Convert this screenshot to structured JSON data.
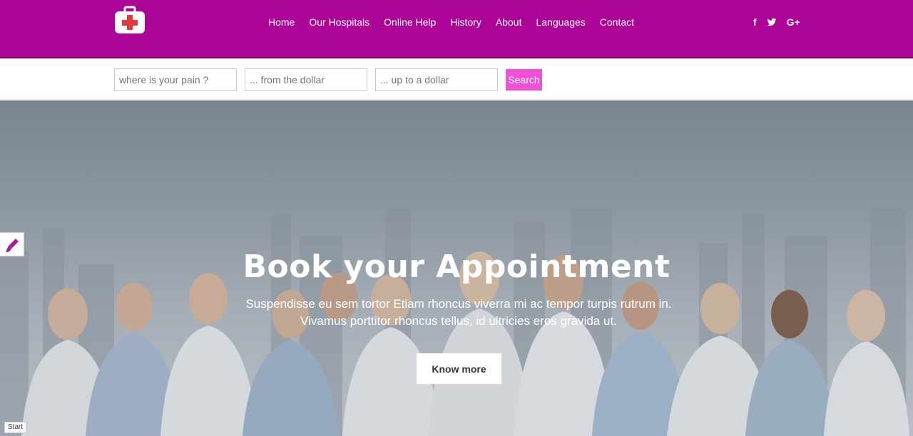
{
  "header": {
    "nav": [
      "Home",
      "Our Hospitals",
      "Online Help",
      "History",
      "About",
      "Languages",
      "Contact"
    ],
    "social": [
      {
        "icon": "facebook-icon",
        "glyph": "f"
      },
      {
        "icon": "twitter-icon",
        "glyph": "🐦"
      },
      {
        "icon": "google-plus-icon",
        "glyph": "G+"
      }
    ]
  },
  "search": {
    "pain_placeholder": "where is your pain ?",
    "from_placeholder": "... from the dollar",
    "to_placeholder": "... up to a dollar",
    "button": "Search"
  },
  "hero": {
    "title": "Book your Appointment",
    "subtitle_line1": "Suspendisse eu sem tortor Etiam rhoncus viverra mi ac tempor turpis rutrum in.",
    "subtitle_line2": "Vivamus porttitor rhoncus tellus, id ultricies eros gravida ut.",
    "button": "Know more"
  },
  "footer": {
    "start_label": "Start"
  },
  "colors": {
    "brand": "#ad0498",
    "search_button": "#f24fd9"
  }
}
